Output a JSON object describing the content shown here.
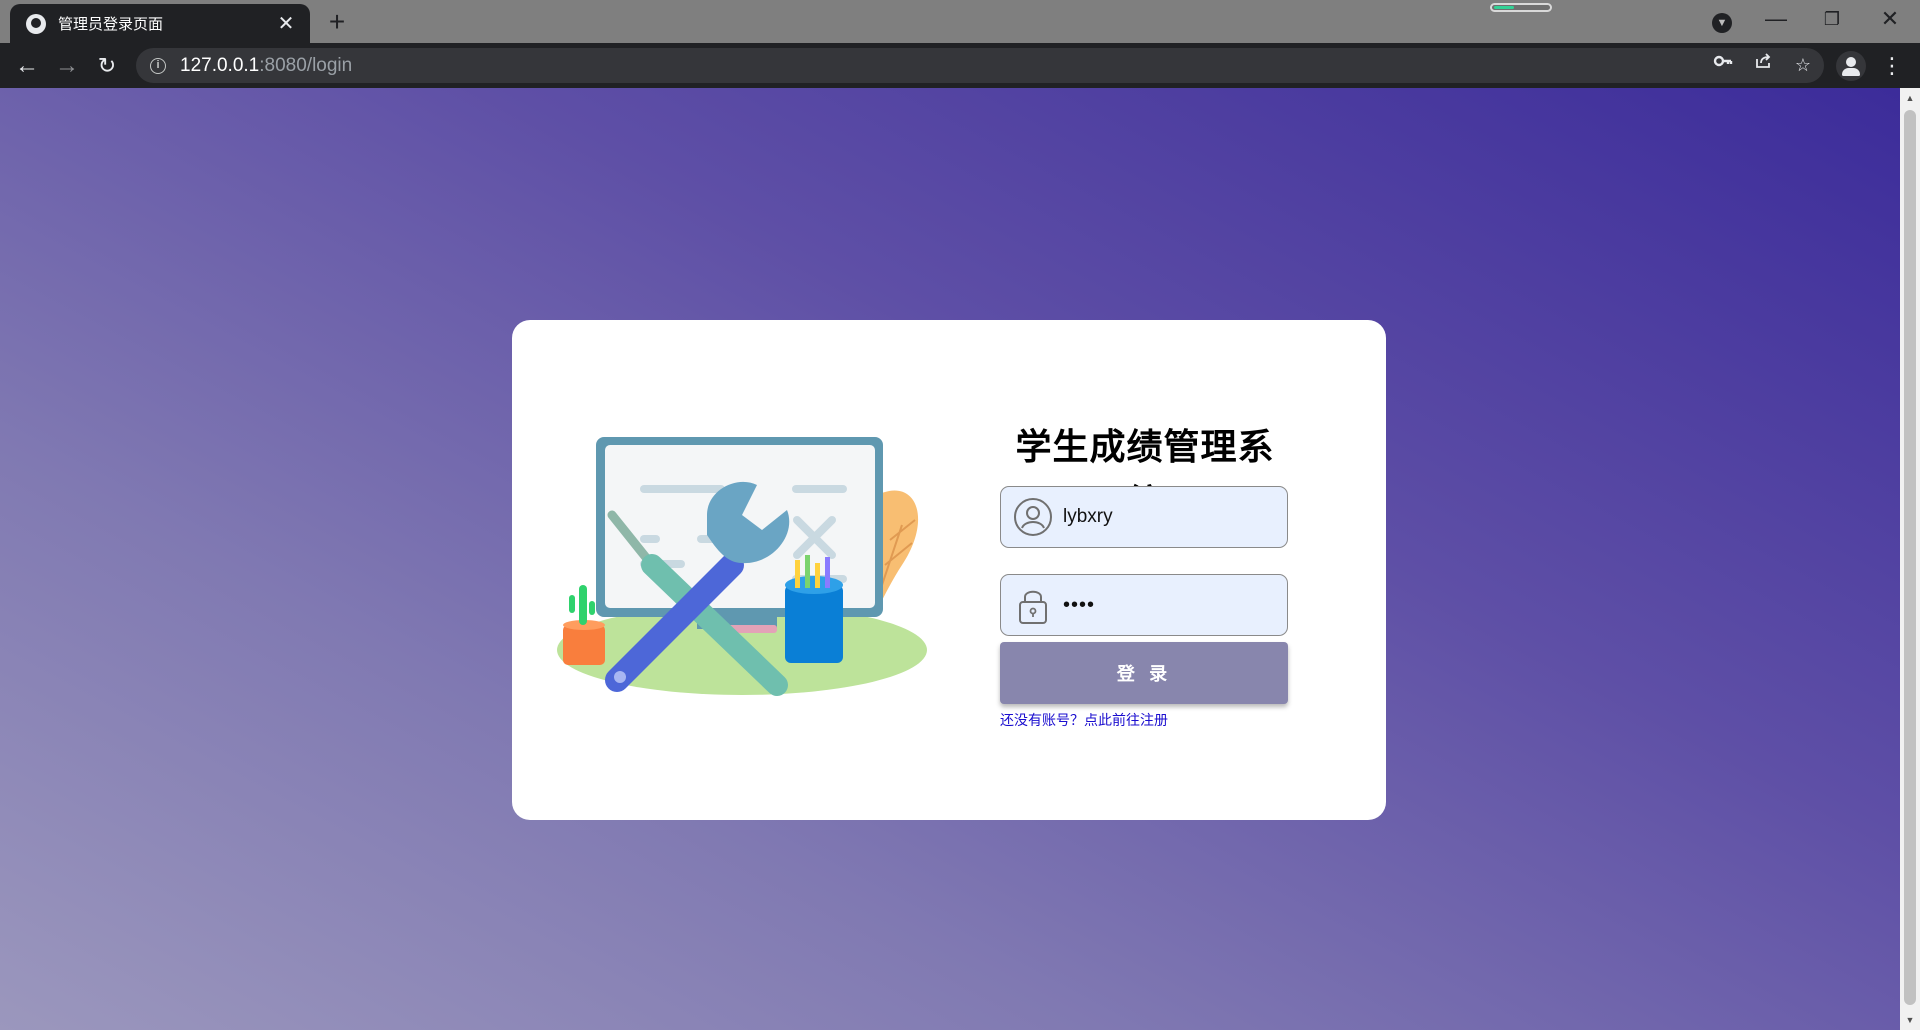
{
  "browser": {
    "tab_title": "管理员登录页面",
    "tab_close": "✕",
    "new_tab": "+",
    "window_controls": {
      "minimize": "—",
      "restore": "❐",
      "close": "✕"
    },
    "url_host": "127.0.0.1",
    "url_rest": ":8080/login",
    "icons": {
      "favicon": "globe-icon",
      "back": "arrow-left-icon",
      "forward": "arrow-right-icon",
      "reload": "reload-icon",
      "site_info": "info-icon",
      "password_key": "key-icon",
      "share": "share-icon",
      "bookmark": "star-icon",
      "profile": "profile-icon",
      "menu": "kebab-menu-icon"
    }
  },
  "login": {
    "title": "学生成绩管理系统",
    "username_value": "lybxry",
    "password_value": "••••",
    "submit_label": "登 录",
    "register_link": "还没有账号？点此前往注册"
  },
  "colors": {
    "page_gradient_start": "#9b97bd",
    "page_gradient_end": "#3c2c9a",
    "input_bg": "#e8f0fe",
    "button_bg": "#8886ad",
    "link": "#1a0dcf"
  }
}
